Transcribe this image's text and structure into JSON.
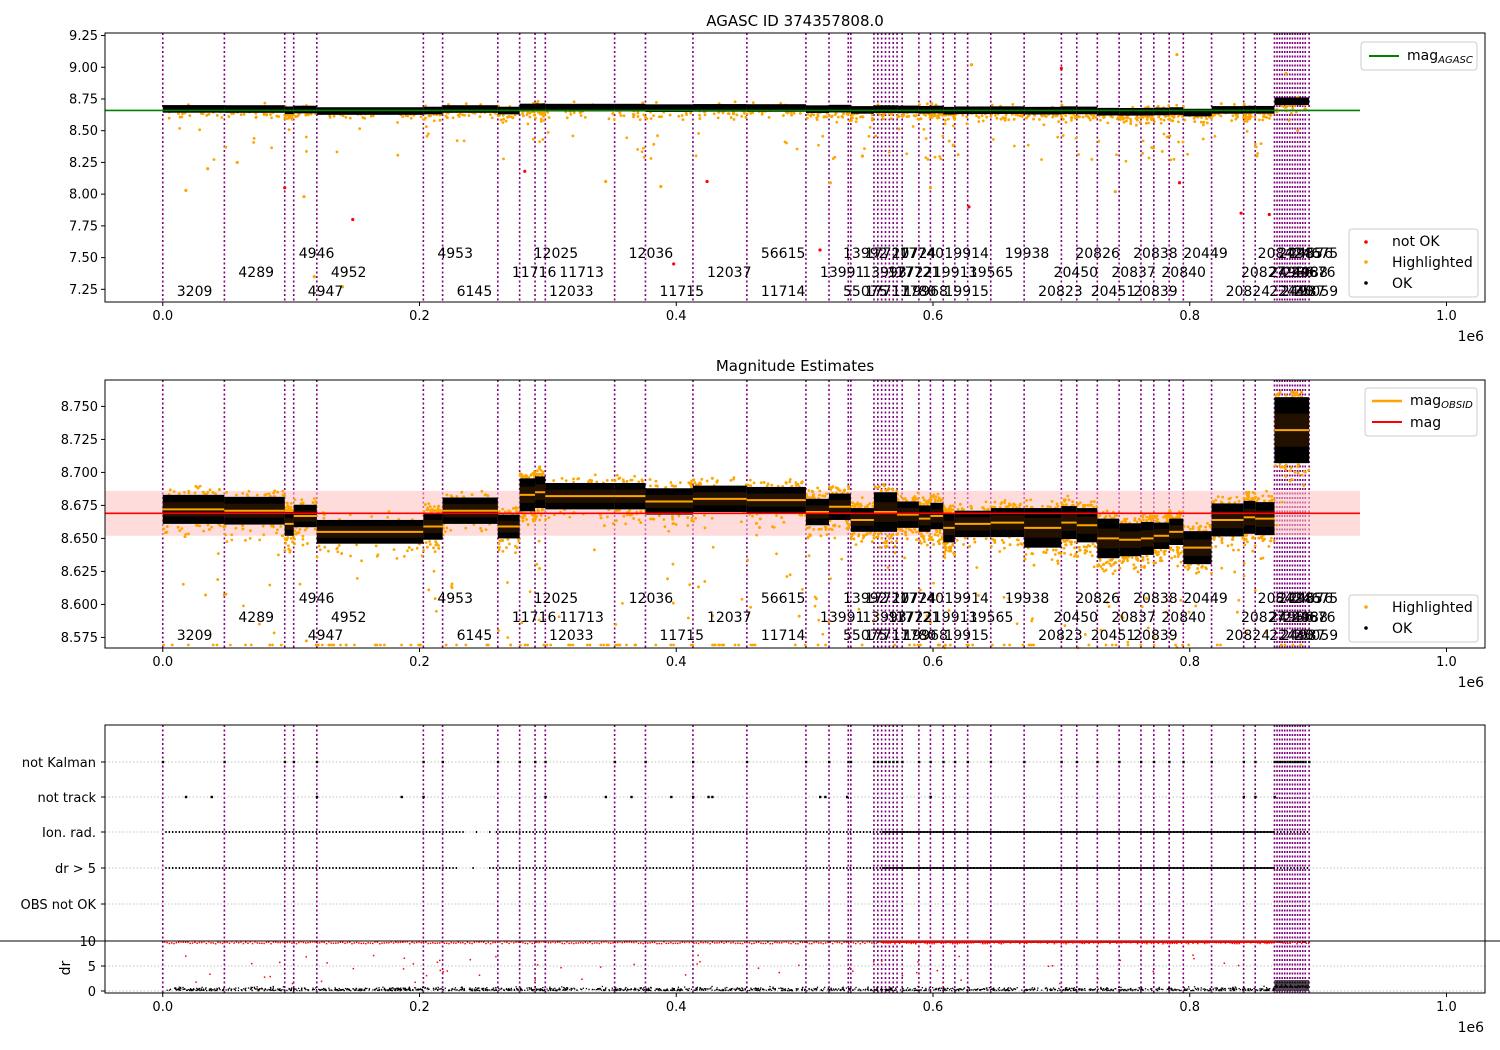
{
  "figure": {
    "width": 1500,
    "height": 1050
  },
  "colors": {
    "obsid_line": "#800080",
    "ok": "#000000",
    "highlighted": "#ffa500",
    "not_ok": "#ff0000",
    "agasc_line": "#008000",
    "mag_line": "#ff0000",
    "mag_band": "#ffc0c0",
    "obsid_mag": "#ffa500",
    "grid": "#b0b0b0"
  },
  "obsid_times": [
    0,
    48000,
    95000,
    102000,
    120000,
    203000,
    218000,
    261000,
    278000,
    290000,
    298000,
    352000,
    376000,
    413000,
    455000,
    501000,
    519000,
    534000,
    536000,
    554000,
    557000,
    560000,
    563000,
    566000,
    569000,
    572000,
    576000,
    589000,
    598000,
    608000,
    617000,
    627000,
    645000,
    671000,
    700000,
    712000,
    728000,
    745000,
    762000,
    772000,
    784000,
    795000,
    817000,
    842000,
    851000,
    866000,
    868000,
    870000,
    872000,
    874000,
    876000,
    878000,
    880000,
    882000,
    884000,
    886000,
    888000,
    890000,
    893000
  ],
  "obsid_labels": [
    {
      "text": "3209",
      "t": 0,
      "row": 0
    },
    {
      "text": "4289",
      "t": 48000,
      "row": 1
    },
    {
      "text": "4946",
      "t": 95000,
      "row": 2
    },
    {
      "text": "4947",
      "t": 102000,
      "row": 0
    },
    {
      "text": "4952",
      "t": 120000,
      "row": 1
    },
    {
      "text": "4953",
      "t": 203000,
      "row": 2
    },
    {
      "text": "6145",
      "t": 218000,
      "row": 0
    },
    {
      "text": "11716",
      "t": 261000,
      "row": 1
    },
    {
      "text": "12025",
      "t": 278000,
      "row": 2
    },
    {
      "text": "12033",
      "t": 290000,
      "row": 0
    },
    {
      "text": "11713",
      "t": 298000,
      "row": 1
    },
    {
      "text": "12036",
      "t": 352000,
      "row": 2
    },
    {
      "text": "11715",
      "t": 376000,
      "row": 0
    },
    {
      "text": "12037",
      "t": 413000,
      "row": 1
    },
    {
      "text": "56615",
      "t": 455000,
      "row": 2
    },
    {
      "text": "11714",
      "t": 455000,
      "row": 0
    },
    {
      "text": "13991",
      "t": 501000,
      "row": 1
    },
    {
      "text": "13992",
      "t": 519000,
      "row": 2
    },
    {
      "text": "55075",
      "t": 519000,
      "row": 0
    },
    {
      "text": "13993",
      "t": 534000,
      "row": 1
    },
    {
      "text": "17711",
      "t": 536000,
      "row": 0
    },
    {
      "text": "17720",
      "t": 536000,
      "row": 2
    },
    {
      "text": "17722",
      "t": 554000,
      "row": 1
    },
    {
      "text": "17724",
      "t": 557000,
      "row": 2
    },
    {
      "text": "17780",
      "t": 557000,
      "row": 0
    },
    {
      "text": "17721",
      "t": 560000,
      "row": 1
    },
    {
      "text": "17740",
      "t": 563000,
      "row": 2
    },
    {
      "text": "19968",
      "t": 566000,
      "row": 0
    },
    {
      "text": "19913",
      "t": 589000,
      "row": 1
    },
    {
      "text": "19914",
      "t": 598000,
      "row": 2
    },
    {
      "text": "19915",
      "t": 598000,
      "row": 0
    },
    {
      "text": "19565",
      "t": 617000,
      "row": 1
    },
    {
      "text": "19938",
      "t": 645000,
      "row": 2
    },
    {
      "text": "20823",
      "t": 671000,
      "row": 0
    },
    {
      "text": "20450",
      "t": 683000,
      "row": 1
    },
    {
      "text": "20826",
      "t": 700000,
      "row": 2
    },
    {
      "text": "20451",
      "t": 712000,
      "row": 0
    },
    {
      "text": "20837",
      "t": 728000,
      "row": 1
    },
    {
      "text": "20838",
      "t": 745000,
      "row": 2
    },
    {
      "text": "20839",
      "t": 745000,
      "row": 0
    },
    {
      "text": "20840",
      "t": 767000,
      "row": 1
    },
    {
      "text": "20449",
      "t": 784000,
      "row": 2
    },
    {
      "text": "20824",
      "t": 817000,
      "row": 0
    },
    {
      "text": "20827",
      "t": 829000,
      "row": 1
    },
    {
      "text": "20842",
      "t": 842000,
      "row": 2
    },
    {
      "text": "22440",
      "t": 851000,
      "row": 0
    },
    {
      "text": "24986",
      "t": 851000,
      "row": 1
    },
    {
      "text": "24985",
      "t": 858000,
      "row": 2
    },
    {
      "text": "24987",
      "t": 860000,
      "row": 0
    },
    {
      "text": "24988",
      "t": 862000,
      "row": 1
    },
    {
      "text": "24676",
      "t": 866000,
      "row": 2
    },
    {
      "text": "24675",
      "t": 870000,
      "row": 2
    },
    {
      "text": "25059",
      "t": 870000,
      "row": 0
    },
    {
      "text": "24676",
      "t": 868000,
      "row": 1
    }
  ],
  "ticks": {
    "x_labels": [
      "0.0",
      "0.2",
      "0.4",
      "0.6",
      "0.8",
      "1.0"
    ],
    "x_values": [
      0,
      200000,
      400000,
      600000,
      800000,
      1000000
    ],
    "x_offset": "1e6",
    "p1_y": [
      "7.25",
      "7.50",
      "7.75",
      "8.00",
      "8.25",
      "8.50",
      "8.75",
      "9.00",
      "9.25"
    ],
    "p2_y": [
      "8.575",
      "8.600",
      "8.625",
      "8.650",
      "8.675",
      "8.700",
      "8.725",
      "8.750"
    ],
    "p3_flags": [
      "not Kalman",
      "not track",
      "Ion. rad.",
      "dr > 5",
      "OBS not OK"
    ],
    "p3_dr": [
      "0",
      "5",
      "10"
    ]
  },
  "panel1": {
    "title": "AGASC ID 374357808.0",
    "legend_top": {
      "entry": "mag",
      "sub": "AGASC"
    },
    "legend_bottom": [
      "not OK",
      "Highlighted",
      "OK"
    ],
    "mag_agasc": 8.66,
    "ylim": [
      7.15,
      9.27
    ]
  },
  "panel2": {
    "title": "Magnitude Estimates",
    "legend_top": [
      {
        "entry": "mag",
        "sub": "OBSID"
      },
      {
        "entry": "mag",
        "sub": ""
      }
    ],
    "legend_bottom": [
      "Highlighted",
      "OK"
    ],
    "mag": 8.669,
    "mag_err": 0.017,
    "ylim": [
      8.567,
      8.77
    ]
  },
  "panel3": {
    "ylabel": "dr",
    "dr_threshold": 10
  },
  "chart_data": {
    "type": "scatter",
    "title": "AGASC ID 374357808.0",
    "xlim": [
      -45000,
      1030000
    ],
    "x_offset_label": "1e6",
    "time_span": [
      0,
      893000
    ],
    "obsid_segments": [
      {
        "t0": 0,
        "t1": 48000,
        "mag": 8.672,
        "h": 0.022
      },
      {
        "t0": 48000,
        "t1": 95000,
        "mag": 8.671,
        "h": 0.021
      },
      {
        "t0": 95000,
        "t1": 102000,
        "mag": 8.661,
        "h": 0.018
      },
      {
        "t0": 102000,
        "t1": 120000,
        "mag": 8.667,
        "h": 0.017
      },
      {
        "t0": 120000,
        "t1": 203000,
        "mag": 8.655,
        "h": 0.018
      },
      {
        "t0": 203000,
        "t1": 218000,
        "mag": 8.659,
        "h": 0.02
      },
      {
        "t0": 218000,
        "t1": 261000,
        "mag": 8.671,
        "h": 0.02
      },
      {
        "t0": 261000,
        "t1": 278000,
        "mag": 8.659,
        "h": 0.018
      },
      {
        "t0": 278000,
        "t1": 290000,
        "mag": 8.683,
        "h": 0.025
      },
      {
        "t0": 290000,
        "t1": 298000,
        "mag": 8.685,
        "h": 0.024
      },
      {
        "t0": 298000,
        "t1": 352000,
        "mag": 8.682,
        "h": 0.02
      },
      {
        "t0": 352000,
        "t1": 376000,
        "mag": 8.682,
        "h": 0.02
      },
      {
        "t0": 376000,
        "t1": 413000,
        "mag": 8.678,
        "h": 0.02
      },
      {
        "t0": 413000,
        "t1": 455000,
        "mag": 8.68,
        "h": 0.02
      },
      {
        "t0": 455000,
        "t1": 501000,
        "mag": 8.679,
        "h": 0.02
      },
      {
        "t0": 501000,
        "t1": 519000,
        "mag": 8.67,
        "h": 0.02
      },
      {
        "t0": 519000,
        "t1": 536000,
        "mag": 8.674,
        "h": 0.02
      },
      {
        "t0": 536000,
        "t1": 554000,
        "mag": 8.664,
        "h": 0.018
      },
      {
        "t0": 554000,
        "t1": 572000,
        "mag": 8.67,
        "h": 0.03
      },
      {
        "t0": 572000,
        "t1": 589000,
        "mag": 8.668,
        "h": 0.02
      },
      {
        "t0": 589000,
        "t1": 598000,
        "mag": 8.665,
        "h": 0.02
      },
      {
        "t0": 598000,
        "t1": 608000,
        "mag": 8.667,
        "h": 0.02
      },
      {
        "t0": 608000,
        "t1": 617000,
        "mag": 8.658,
        "h": 0.022
      },
      {
        "t0": 617000,
        "t1": 645000,
        "mag": 8.661,
        "h": 0.02
      },
      {
        "t0": 645000,
        "t1": 671000,
        "mag": 8.662,
        "h": 0.022
      },
      {
        "t0": 671000,
        "t1": 700000,
        "mag": 8.658,
        "h": 0.03
      },
      {
        "t0": 700000,
        "t1": 712000,
        "mag": 8.662,
        "h": 0.025
      },
      {
        "t0": 712000,
        "t1": 728000,
        "mag": 8.66,
        "h": 0.026
      },
      {
        "t0": 728000,
        "t1": 745000,
        "mag": 8.65,
        "h": 0.03
      },
      {
        "t0": 745000,
        "t1": 762000,
        "mag": 8.649,
        "h": 0.025
      },
      {
        "t0": 762000,
        "t1": 772000,
        "mag": 8.65,
        "h": 0.025
      },
      {
        "t0": 772000,
        "t1": 784000,
        "mag": 8.652,
        "h": 0.02
      },
      {
        "t0": 784000,
        "t1": 795000,
        "mag": 8.655,
        "h": 0.02
      },
      {
        "t0": 795000,
        "t1": 817000,
        "mag": 8.643,
        "h": 0.025
      },
      {
        "t0": 817000,
        "t1": 842000,
        "mag": 8.664,
        "h": 0.025
      },
      {
        "t0": 842000,
        "t1": 851000,
        "mag": 8.666,
        "h": 0.025
      },
      {
        "t0": 851000,
        "t1": 866000,
        "mag": 8.665,
        "h": 0.025
      },
      {
        "t0": 866000,
        "t1": 893000,
        "mag": 8.732,
        "h": 0.05
      }
    ],
    "outliers_panel1": [
      {
        "t": 95000,
        "mag": 8.05,
        "status": "not OK"
      },
      {
        "t": 148000,
        "mag": 7.8,
        "status": "not OK"
      },
      {
        "t": 282000,
        "mag": 8.18,
        "status": "not OK"
      },
      {
        "t": 398000,
        "mag": 7.45,
        "status": "not OK"
      },
      {
        "t": 424000,
        "mag": 8.1,
        "status": "not OK"
      },
      {
        "t": 512000,
        "mag": 7.56,
        "status": "not OK"
      },
      {
        "t": 628000,
        "mag": 7.9,
        "status": "not OK"
      },
      {
        "t": 700000,
        "mag": 8.99,
        "status": "not OK"
      },
      {
        "t": 792000,
        "mag": 8.09,
        "status": "not OK"
      },
      {
        "t": 840000,
        "mag": 7.85,
        "status": "not OK"
      },
      {
        "t": 862000,
        "mag": 7.84,
        "status": "not OK"
      },
      {
        "t": 18000,
        "mag": 8.03,
        "status": "Highlighted"
      },
      {
        "t": 35000,
        "mag": 8.2,
        "status": "Highlighted"
      },
      {
        "t": 58000,
        "mag": 8.25,
        "status": "Highlighted"
      },
      {
        "t": 110000,
        "mag": 7.98,
        "status": "Highlighted"
      },
      {
        "t": 118000,
        "mag": 7.35,
        "status": "Highlighted"
      },
      {
        "t": 140000,
        "mag": 7.27,
        "status": "Highlighted"
      },
      {
        "t": 345000,
        "mag": 8.1,
        "status": "Highlighted"
      },
      {
        "t": 388000,
        "mag": 8.06,
        "status": "Highlighted"
      },
      {
        "t": 520000,
        "mag": 8.09,
        "status": "Highlighted"
      },
      {
        "t": 545000,
        "mag": 8.3,
        "status": "Highlighted"
      },
      {
        "t": 598000,
        "mag": 8.05,
        "status": "Highlighted"
      },
      {
        "t": 630000,
        "mag": 9.02,
        "status": "Highlighted"
      },
      {
        "t": 742000,
        "mag": 8.02,
        "status": "Highlighted"
      },
      {
        "t": 790000,
        "mag": 9.1,
        "status": "Highlighted"
      },
      {
        "t": 875000,
        "mag": 8.95,
        "status": "Highlighted"
      }
    ]
  }
}
